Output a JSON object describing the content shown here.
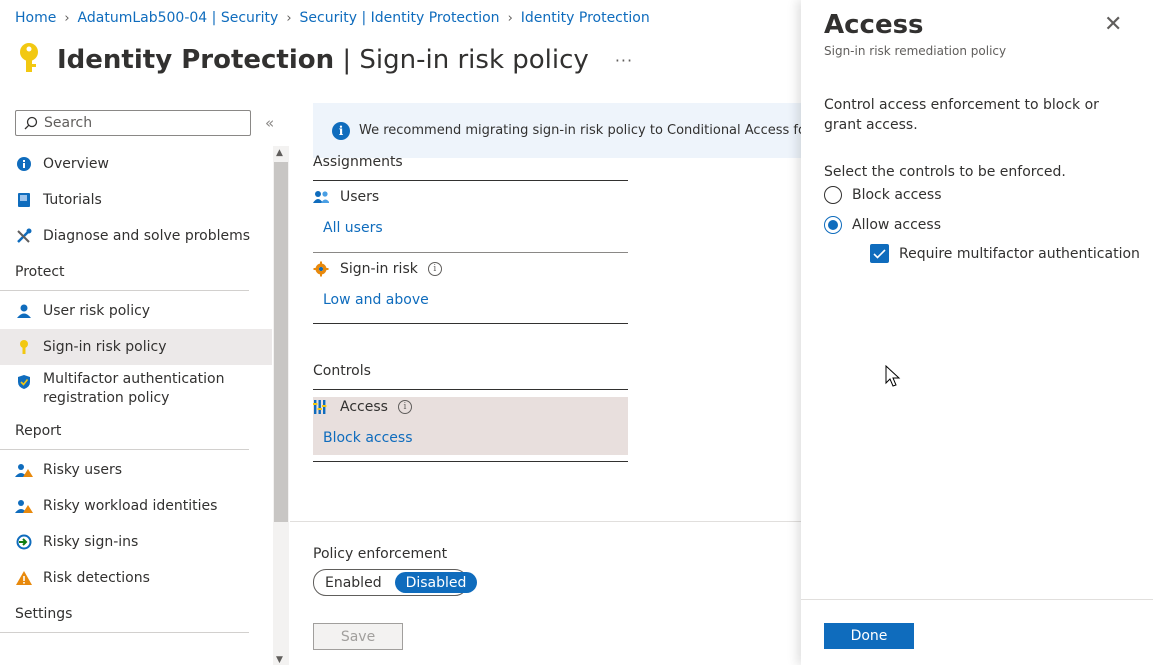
{
  "breadcrumb": [
    "Home",
    "AdatumLab500-04 | Security",
    "Security | Identity Protection",
    "Identity Protection"
  ],
  "page": {
    "title_bold": "Identity Protection",
    "title_rest": " | Sign-in risk policy",
    "more": "···"
  },
  "sidebar": {
    "search_placeholder": "Search",
    "collapse": "«",
    "items_top": [
      {
        "label": "Overview",
        "icon": "info-icon"
      },
      {
        "label": "Tutorials",
        "icon": "book-icon"
      },
      {
        "label": "Diagnose and solve problems",
        "icon": "wrench-icon"
      }
    ],
    "protect_heading": "Protect",
    "protect_items": [
      {
        "label": "User risk policy",
        "icon": "user-icon"
      },
      {
        "label": "Sign-in risk policy",
        "icon": "key-icon",
        "selected": true
      },
      {
        "label": "Multifactor authentication registration policy",
        "icon": "shield-icon"
      }
    ],
    "report_heading": "Report",
    "report_items": [
      {
        "label": "Risky users",
        "icon": "risky-user-icon"
      },
      {
        "label": "Risky workload identities",
        "icon": "workload-icon"
      },
      {
        "label": "Risky sign-ins",
        "icon": "signin-icon"
      },
      {
        "label": "Risk detections",
        "icon": "warning-icon"
      }
    ],
    "settings_heading": "Settings"
  },
  "main": {
    "banner": "We recommend migrating sign-in risk policy to Conditional Access for mo",
    "assignments": "Assignments",
    "users_label": "Users",
    "users_value": "All users",
    "signin_risk_label": "Sign-in risk",
    "signin_risk_value": "Low and above",
    "controls": "Controls",
    "access_label": "Access",
    "access_value": "Block access",
    "policy_enforcement": "Policy enforcement",
    "toggle_enabled": "Enabled",
    "toggle_disabled": "Disabled",
    "save": "Save"
  },
  "panel": {
    "title": "Access",
    "subtitle": "Sign-in risk remediation policy",
    "close": "✕",
    "description": "Control access enforcement to block or grant access.",
    "select_prompt": "Select the controls to be enforced.",
    "block_access": "Block access",
    "allow_access": "Allow access",
    "require_mfa": "Require multifactor authentication",
    "done": "Done"
  },
  "colors": {
    "accent": "#0f6cbd",
    "selected_bg": "#ece9e9",
    "warning": "#e8890c"
  }
}
